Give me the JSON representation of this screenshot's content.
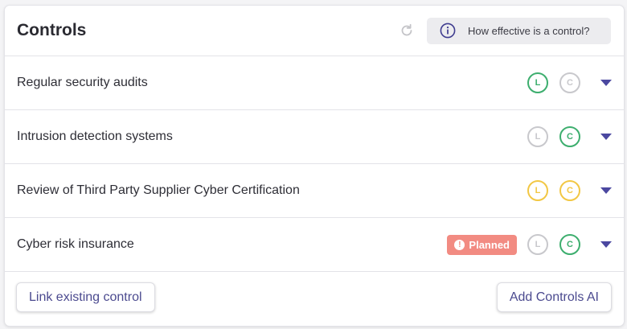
{
  "header": {
    "title": "Controls",
    "help_label": "How effective is a control?"
  },
  "colors": {
    "green": "#3dae6e",
    "grey": "#c8c8cc",
    "yellow": "#f2c744",
    "accent": "#4b48a0",
    "planned": "#f28b82"
  },
  "controls": [
    {
      "name": "Regular security audits",
      "badge": null,
      "likelihood": {
        "letter": "L",
        "status": "green"
      },
      "consequence": {
        "letter": "C",
        "status": "grey"
      }
    },
    {
      "name": "Intrusion detection systems",
      "badge": null,
      "likelihood": {
        "letter": "L",
        "status": "grey"
      },
      "consequence": {
        "letter": "C",
        "status": "green"
      }
    },
    {
      "name": "Review of Third Party Supplier Cyber Certification",
      "badge": null,
      "likelihood": {
        "letter": "L",
        "status": "yellow"
      },
      "consequence": {
        "letter": "C",
        "status": "yellow"
      }
    },
    {
      "name": "Cyber risk insurance",
      "badge": {
        "label": "Planned",
        "icon": "!"
      },
      "likelihood": {
        "letter": "L",
        "status": "grey"
      },
      "consequence": {
        "letter": "C",
        "status": "green"
      }
    }
  ],
  "footer": {
    "link_label": "Link existing control",
    "add_label": "Add Controls AI"
  }
}
